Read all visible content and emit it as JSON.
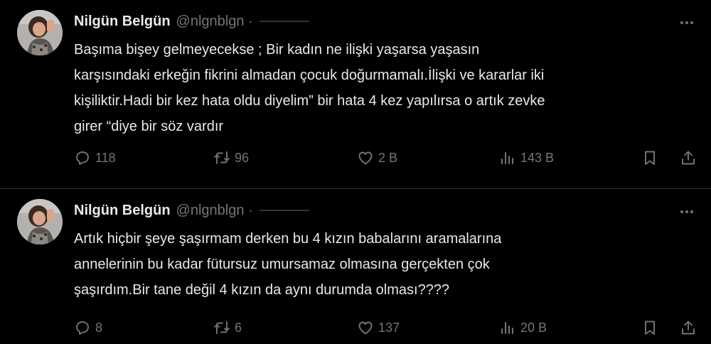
{
  "colors": {
    "background": "#000000",
    "text": "#e7e9ea",
    "muted": "#71767b",
    "divider": "#2f3336"
  },
  "icons": {
    "reply": "reply-icon",
    "retweet": "retweet-icon",
    "like": "heart-icon",
    "views": "views-chart-icon",
    "bookmark": "bookmark-icon",
    "share": "share-icon",
    "more": "more-dots-icon"
  },
  "tweets": [
    {
      "author_name": "Nilgün Belgün",
      "author_handle": "@nlgnblgn",
      "separator": "·",
      "text": "Başıma bişey gelmeyecekse ; Bir kadın ne ilişki  yaşarsa yaşasın\nkarşısındaki erkeğin fikrini almadan çocuk doğurmamalı.İlişki ve kararlar iki\nkişiliktir.Hadi bir kez hata oldu diyelim” bir hata 4 kez yapılırsa o artık zevke\ngirer “diye bir söz vardır",
      "replies": "118",
      "retweets": "96",
      "likes": "2 B",
      "views": "143 B"
    },
    {
      "author_name": "Nilgün Belgün",
      "author_handle": "@nlgnblgn",
      "separator": "·",
      "text": "Artık hiçbir şeye şaşırmam derken bu 4 kızın babalarını aramalarına\nannelerinin bu kadar fütursuz umursamaz olmasına gerçekten çok\nşaşırdım.Bir tane değil 4 kızın da aynı durumda olması????",
      "replies": "8",
      "retweets": "6",
      "likes": "137",
      "views": "20 B"
    }
  ]
}
